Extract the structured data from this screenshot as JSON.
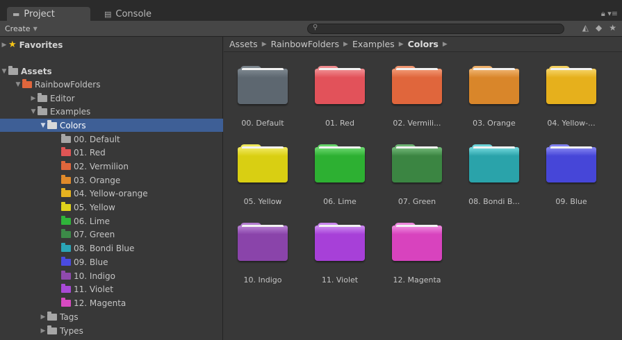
{
  "tabs": [
    {
      "label": "Project",
      "icon": "folder-icon",
      "active": true
    },
    {
      "label": "Console",
      "icon": "console-icon",
      "active": false
    }
  ],
  "toolbar": {
    "create_label": "Create",
    "search_placeholder": ""
  },
  "breadcrumb": [
    "Assets",
    "RainbowFolders",
    "Examples",
    "Colors"
  ],
  "tree": {
    "favorites": "Favorites",
    "assets": "Assets",
    "rainbow": "RainbowFolders",
    "editor": "Editor",
    "examples": "Examples",
    "colors": "Colors",
    "items": [
      {
        "label": "00. Default",
        "color": "#a6a6a6"
      },
      {
        "label": "01. Red",
        "color": "#e05555"
      },
      {
        "label": "02. Vermilion",
        "color": "#e0663c"
      },
      {
        "label": "03. Orange",
        "color": "#e08a2a"
      },
      {
        "label": "04. Yellow-orange",
        "color": "#e6b320"
      },
      {
        "label": "05. Yellow",
        "color": "#dfd21c"
      },
      {
        "label": "06. Lime",
        "color": "#2fb43a"
      },
      {
        "label": "07. Green",
        "color": "#3c8a48"
      },
      {
        "label": "08. Bondi Blue",
        "color": "#2aa5b6"
      },
      {
        "label": "09. Blue",
        "color": "#4a4be0"
      },
      {
        "label": "10. Indigo",
        "color": "#8f4aae"
      },
      {
        "label": "11. Violet",
        "color": "#a84ad6"
      },
      {
        "label": "12. Magenta",
        "color": "#d84ac2"
      }
    ],
    "tags": "Tags",
    "types": "Types"
  },
  "grid": [
    {
      "label": "00. Default",
      "color": "#5d6770",
      "light": "#7b858d"
    },
    {
      "label": "01. Red",
      "color": "#e2525a",
      "light": "#ef8a8e"
    },
    {
      "label": "02. Vermili...",
      "color": "#e0663c",
      "light": "#f09570"
    },
    {
      "label": "03. Orange",
      "color": "#d9862a",
      "light": "#eeb06a"
    },
    {
      "label": "04. Yellow-...",
      "color": "#e6b01c",
      "light": "#f4d060"
    },
    {
      "label": "05. Yellow",
      "color": "#d9cf12",
      "light": "#efe75a"
    },
    {
      "label": "06. Lime",
      "color": "#2db032",
      "light": "#66d46a"
    },
    {
      "label": "07. Green",
      "color": "#3b8542",
      "light": "#6eb474"
    },
    {
      "label": "08. Bondi B...",
      "color": "#2aa3aa",
      "light": "#6cd3d8"
    },
    {
      "label": "09. Blue",
      "color": "#4646d8",
      "light": "#8080ef"
    },
    {
      "label": "10. Indigo",
      "color": "#8a44aa",
      "light": "#b37bcf"
    },
    {
      "label": "11. Violet",
      "color": "#a740d8",
      "light": "#c985ee"
    },
    {
      "label": "12. Magenta",
      "color": "#d843be",
      "light": "#ed86dc"
    }
  ],
  "colors": {
    "selection": "#3e5f96",
    "accent_star": "#f5c518"
  }
}
